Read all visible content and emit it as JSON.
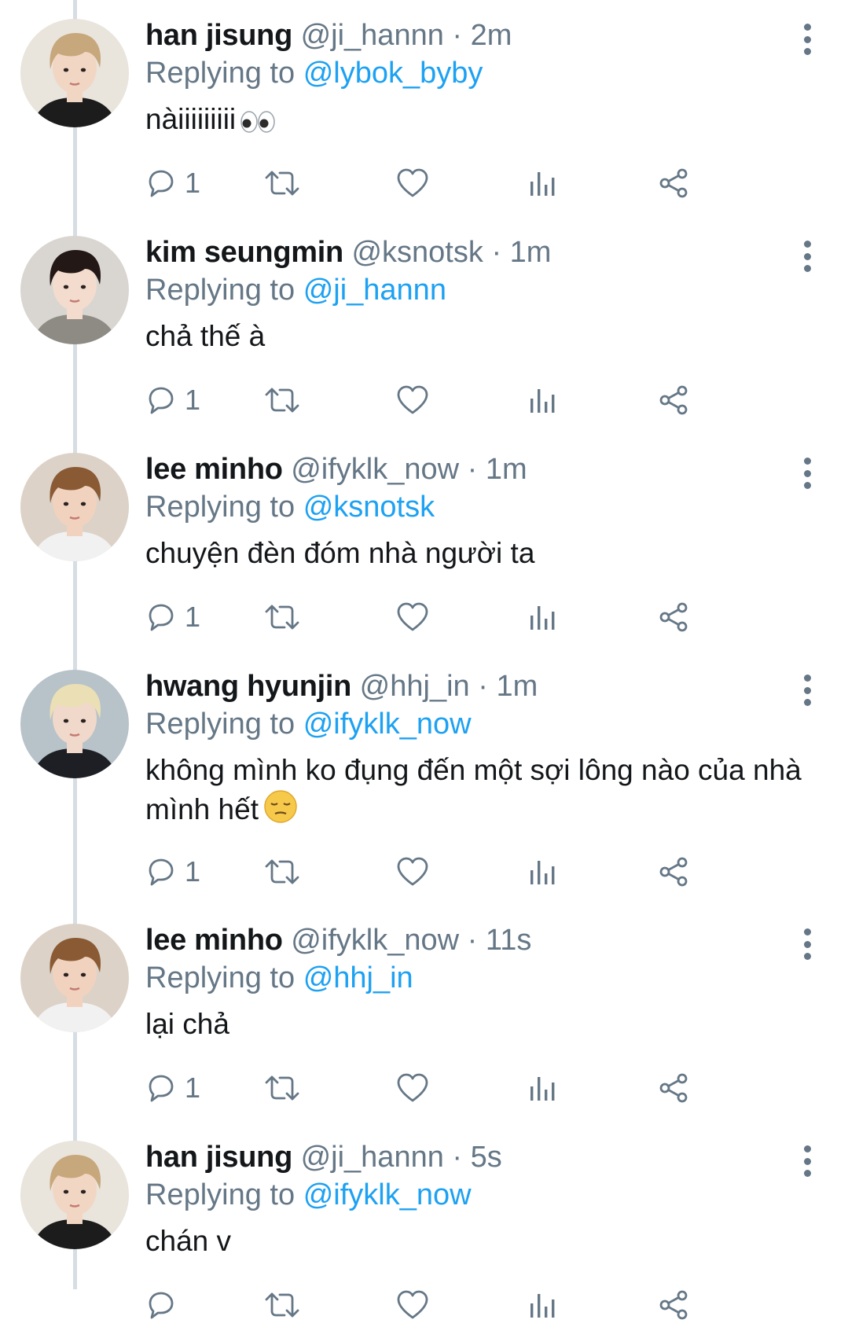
{
  "tweets": [
    {
      "name": "han jisung",
      "handle": "@ji_hannn",
      "time": "2m",
      "replying_prefix": "Replying to",
      "replying_to": "@lybok_byby",
      "text": "nàiiiiiiiii",
      "emoji": "eyes",
      "reply_count": "1",
      "avatar": {
        "hair": "#c7a77c",
        "bg": "#e9e4dc",
        "shirt": "#1c1c1c",
        "skin": "#f2d6c4"
      }
    },
    {
      "name": "kim seungmin",
      "handle": "@ksnotsk",
      "time": "1m",
      "replying_prefix": "Replying to",
      "replying_to": "@ji_hannn",
      "text": "chả thế à",
      "emoji": "",
      "reply_count": "1",
      "avatar": {
        "hair": "#231815",
        "bg": "#d9d6d1",
        "shirt": "#8e8a84",
        "skin": "#f3dccd"
      }
    },
    {
      "name": "lee minho",
      "handle": "@ifyklk_now",
      "time": "1m",
      "replying_prefix": "Replying to",
      "replying_to": "@ksnotsk",
      "text": "chuyện đèn đóm nhà người ta",
      "emoji": "",
      "reply_count": "1",
      "avatar": {
        "hair": "#8a5a35",
        "bg": "#dcd2c7",
        "shirt": "#f1f1f1",
        "skin": "#f1d2bf"
      }
    },
    {
      "name": "hwang hyunjin",
      "handle": "@hhj_in",
      "time": "1m",
      "replying_prefix": "Replying to",
      "replying_to": "@ifyklk_now",
      "text": "không mình ko đụng đến một sợi lông nào của nhà mình hết",
      "emoji": "pensive",
      "reply_count": "1",
      "avatar": {
        "hair": "#eadfb5",
        "bg": "#b7c2c9",
        "shirt": "#1d1f24",
        "skin": "#f0d9ca"
      }
    },
    {
      "name": "lee minho",
      "handle": "@ifyklk_now",
      "time": "11s",
      "replying_prefix": "Replying to",
      "replying_to": "@hhj_in",
      "text": "lại chả",
      "emoji": "",
      "reply_count": "1",
      "avatar": {
        "hair": "#8a5a35",
        "bg": "#dcd2c7",
        "shirt": "#f1f1f1",
        "skin": "#f1d2bf"
      }
    },
    {
      "name": "han jisung",
      "handle": "@ji_hannn",
      "time": "5s",
      "replying_prefix": "Replying to",
      "replying_to": "@ifyklk_now",
      "text": "chán v",
      "emoji": "",
      "reply_count": "",
      "avatar": {
        "hair": "#c7a77c",
        "bg": "#e9e4dc",
        "shirt": "#1c1c1c",
        "skin": "#f2d6c4"
      }
    }
  ],
  "colors": {
    "link": "#1da1f2",
    "secondary_text": "#657786",
    "primary_text": "#14171a",
    "thread_line": "#d6dde3"
  },
  "icons": [
    "reply-icon",
    "retweet-icon",
    "like-icon",
    "analytics-icon",
    "share-icon",
    "more-options-icon"
  ]
}
